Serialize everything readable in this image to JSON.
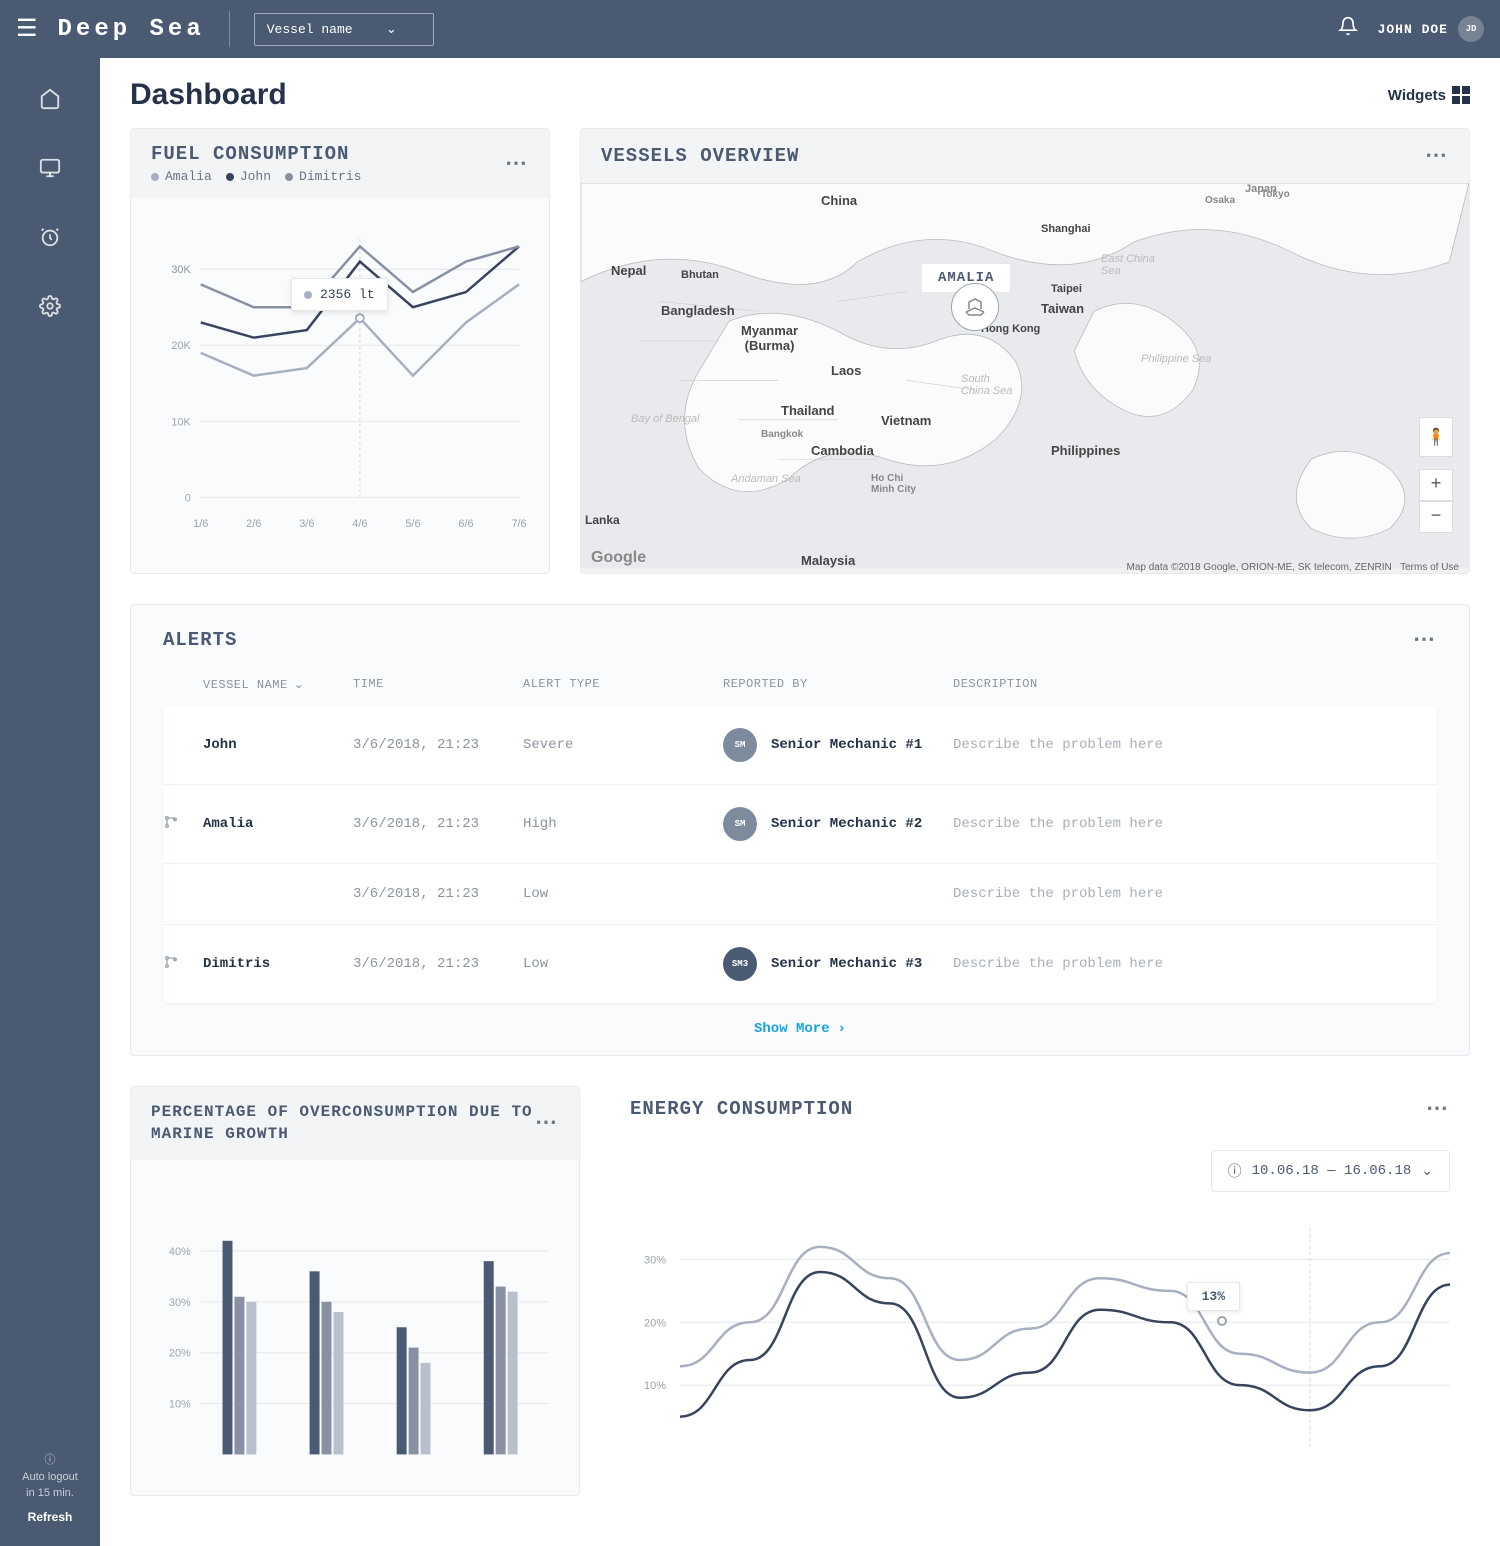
{
  "header": {
    "logo": "Deep Sea",
    "vessel_placeholder": "Vessel name",
    "user_name": "JOHN DOE",
    "user_initials": "JD"
  },
  "sidebar": {
    "logout_line1": "Auto logout",
    "logout_line2": "in 15 min.",
    "refresh": "Refresh"
  },
  "page_title": "Dashboard",
  "widgets_label": "Widgets",
  "fuel": {
    "title": "FUEL CONSUMPTION",
    "legend": [
      "Amalia",
      "John",
      "Dimitris"
    ],
    "tooltip": "2356 lt"
  },
  "map": {
    "title": "VESSELS OVERVIEW",
    "pin_label": "AMALIA",
    "google": "Google",
    "copyright": "Map data ©2018 Google, ORION-ME, SK telecom, ZENRIN",
    "terms": "Terms of Use",
    "labels": {
      "china": "China",
      "japan": "Japan",
      "osaka": "Osaka",
      "tokyo": "Tokyo",
      "shanghai": "Shanghai",
      "nepal": "Nepal",
      "bhutan": "Bhutan",
      "bangladesh": "Bangladesh",
      "myanmar": "Myanmar\n(Burma)",
      "taipei": "Taipei",
      "taiwan": "Taiwan",
      "hongkong": "Hong Kong",
      "laos": "Laos",
      "thailand": "Thailand",
      "vietnam": "Vietnam",
      "cambodia": "Cambodia",
      "bangkok": "Bangkok",
      "hcmc": "Ho Chi\nMinh City",
      "philippines": "Philippines",
      "lanka": "Lanka",
      "malaysia": "Malaysia",
      "bay_of_bengal": "Bay of Bengal",
      "andaman": "Andaman Sea",
      "south_china": "South\nChina Sea",
      "philippine_sea": "Philippine Sea",
      "east_china": "East China\nSea"
    }
  },
  "alerts": {
    "title": "ALERTS",
    "columns": [
      "VESSEL NAME",
      "TIME",
      "ALERT TYPE",
      "REPORTED BY",
      "DESCRIPTION"
    ],
    "rows": [
      {
        "icon": false,
        "vessel": "John",
        "time": "3/6/2018, 21:23",
        "type": "Severe",
        "badge": "SM",
        "reporter": "Senior Mechanic #1",
        "desc": "Describe the problem here",
        "dark": false
      },
      {
        "icon": true,
        "vessel": "Amalia",
        "time": "3/6/2018, 21:23",
        "type": "High",
        "badge": "SM",
        "reporter": "Senior Mechanic #2",
        "desc": "Describe the problem here",
        "dark": false
      },
      {
        "icon": false,
        "vessel": "",
        "time": "3/6/2018, 21:23",
        "type": "Low",
        "badge": "",
        "reporter": "",
        "desc": "Describe the problem here",
        "dark": false
      },
      {
        "icon": true,
        "vessel": "Dimitris",
        "time": "3/6/2018, 21:23",
        "type": "Low",
        "badge": "SM3",
        "reporter": "Senior Mechanic #3",
        "desc": "Describe the problem here",
        "dark": true
      }
    ],
    "show_more": "Show More"
  },
  "over": {
    "title": "PERCENTAGE OF OVERCONSUMPTION DUE TO MARINE GROWTH"
  },
  "energy": {
    "title": "ENERGY CONSUMPTION",
    "date_range": "10.06.18 — 16.06.18",
    "tooltip": "13%"
  },
  "chart_data": [
    {
      "id": "fuel",
      "type": "line",
      "categories": [
        "1/6",
        "2/6",
        "3/6",
        "4/6",
        "5/6",
        "6/6",
        "7/6"
      ],
      "series": [
        {
          "name": "Amalia",
          "color": "#a7b0c0",
          "values": [
            19000,
            16000,
            17000,
            23560,
            16000,
            23000,
            28000
          ]
        },
        {
          "name": "John",
          "color": "#36445e",
          "values": [
            23000,
            21000,
            22000,
            31000,
            25000,
            27000,
            33000
          ]
        },
        {
          "name": "Dimitris",
          "color": "#8791a3",
          "values": [
            28000,
            25000,
            25000,
            33000,
            27000,
            31000,
            33000
          ]
        }
      ],
      "ylabel": "",
      "xlabel": "",
      "y_ticks": [
        0,
        10000,
        20000,
        30000,
        30000
      ],
      "y_tick_labels": [
        "0",
        "10K",
        "20K",
        "30K",
        "30K"
      ],
      "tooltip_point": {
        "series": "Amalia",
        "x": "4/6",
        "label": "2356 lt"
      }
    },
    {
      "id": "overconsumption",
      "type": "bar",
      "y_ticks": [
        10,
        20,
        30,
        40
      ],
      "y_tick_labels": [
        "10%",
        "20%",
        "30%",
        "40%"
      ],
      "groups": 4,
      "bars_per_group": 3,
      "series": [
        {
          "name": "dark",
          "color": "#4a5a72",
          "values": [
            42,
            36,
            25,
            38
          ]
        },
        {
          "name": "mid",
          "color": "#8791a3",
          "values": [
            31,
            30,
            21,
            33
          ]
        },
        {
          "name": "light",
          "color": "#b8c0cc",
          "values": [
            30,
            28,
            18,
            32
          ]
        }
      ],
      "ylim": [
        0,
        45
      ]
    },
    {
      "id": "energy",
      "type": "line",
      "y_ticks": [
        10,
        20,
        30
      ],
      "y_tick_labels": [
        "10%",
        "20%",
        "30%"
      ],
      "series": [
        {
          "name": "light",
          "color": "#a7b0c0",
          "values": [
            13,
            20,
            32,
            27,
            14,
            19,
            27,
            25,
            15,
            12,
            20,
            31
          ]
        },
        {
          "name": "dark",
          "color": "#36445e",
          "values": [
            5,
            14,
            28,
            23,
            8,
            12,
            22,
            20,
            10,
            6,
            13,
            26
          ]
        }
      ],
      "tooltip_point": {
        "series": "dark",
        "index": 9,
        "label": "13%"
      },
      "ylim": [
        0,
        35
      ]
    }
  ]
}
